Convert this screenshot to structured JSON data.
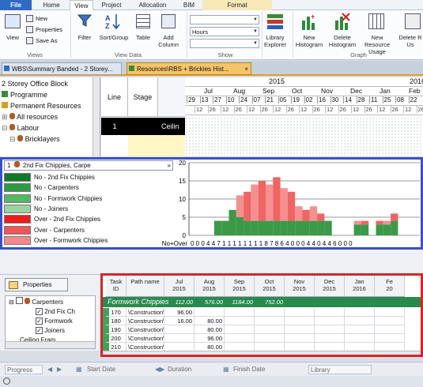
{
  "ribbon_tabs": [
    "File",
    "Home",
    "View",
    "Project",
    "Allocation",
    "BIM",
    "Format"
  ],
  "ribbon": {
    "views": {
      "view_label": "View",
      "new_label": "New",
      "properties_label": "Properties",
      "saveas_label": "Save As",
      "group_label": "Views"
    },
    "viewdata": {
      "filter_label": "Filter",
      "sortgroup_label": "Sort/Group",
      "table_label": "Table",
      "addcolumn_label": "Add Column",
      "group_label": "View Data"
    },
    "show": {
      "combo1": "",
      "combo2": "Hours",
      "combo3": "",
      "group_label": "Show"
    },
    "library_label": "Library Explorer",
    "graph": {
      "new_hist": "New Histogram",
      "delete_hist": "Delete Histogram",
      "new_usage": "New Resource Usage",
      "delete_usage": "Delete R Us",
      "group_label": "Graph"
    }
  },
  "doc_tabs": [
    "WBS\\Summary Banded - 2 Storey...",
    "Resources\\RBS + Brickies Hist..."
  ],
  "tree_top": [
    "2 Storey Office Block",
    "Programme",
    "Permanent Resources",
    "All resources",
    "Labour",
    "Bricklayers"
  ],
  "grid_top": {
    "line_header": "Line",
    "stage_header": "Stage",
    "row_line": "1",
    "row_text": "Ceilin"
  },
  "timeline": {
    "year1": "2015",
    "year2": "2016",
    "months": [
      "Jul",
      "Aug",
      "Sep",
      "Oct",
      "Nov",
      "Dec",
      "Jan",
      "Feb"
    ],
    "weeks1": [
      "29",
      "13",
      "27",
      "10",
      "24",
      "07",
      "21",
      "05",
      "19",
      "02",
      "16",
      "30",
      "14",
      "28",
      "11",
      "25",
      "08",
      "22"
    ],
    "weeks2": [
      "12",
      "26",
      "12",
      "26",
      "12",
      "26",
      "12",
      "26",
      "12",
      "26",
      "12",
      "26",
      "12",
      "26",
      "12",
      "26",
      "12",
      "26"
    ]
  },
  "histogram": {
    "selector": "2nd Fix Chippies, Carpe",
    "legend": [
      {
        "label": "No - 2nd Fix Chippies",
        "color": "#0f7a2a"
      },
      {
        "label": "No - Carpenters",
        "color": "#2f9a45"
      },
      {
        "label": "No - Formwork Chippies",
        "color": "#55b862"
      },
      {
        "label": "No - Joiners",
        "color": "#9bd39f"
      },
      {
        "label": "Over - 2nd Fix Chippies",
        "color": "#ee1c1c"
      },
      {
        "label": "Over - Carpenters",
        "color": "#f05656"
      },
      {
        "label": "Over - Formwork Chippies",
        "color": "#f58888"
      }
    ],
    "yticks": [
      "20",
      "15",
      "10",
      "5",
      "0"
    ],
    "nolabel": "No+Over",
    "values_row": "0 0 0 4 4 7 1 1 1 1 1 1 1 1 8 7 8 6 4 0 0 0 4 4 0 4 4 6 0 0 0"
  },
  "props_button": "Properties",
  "tree_bottom": [
    "Carpenters",
    "2nd Fix Ch",
    "Formwork",
    "Joiners",
    "Ceiling Fram"
  ],
  "bottom_grid": {
    "headers": [
      {
        "l1": "Task",
        "l2": "ID"
      },
      {
        "l1": "Path name",
        "l2": ""
      },
      {
        "l1": "Jul",
        "l2": "2015"
      },
      {
        "l1": "Aug",
        "l2": "2015"
      },
      {
        "l1": "Sep",
        "l2": "2015"
      },
      {
        "l1": "Oct",
        "l2": "2015"
      },
      {
        "l1": "Nov",
        "l2": "2015"
      },
      {
        "l1": "Dec",
        "l2": "2015"
      },
      {
        "l1": "Jan",
        "l2": "2016"
      },
      {
        "l1": "Fe",
        "l2": "20"
      }
    ],
    "group_row": {
      "name": "Formwork Chippies",
      "values": [
        "112.00",
        "576.00",
        "1184.00",
        "752.00",
        "",
        "",
        "",
        ""
      ]
    },
    "rows": [
      {
        "id": "170",
        "path": "\\Construction\\S",
        "values": [
          "96.00",
          "",
          "",
          "",
          "",
          "",
          "",
          ""
        ]
      },
      {
        "id": "180",
        "path": "\\Construction\\S",
        "values": [
          "16.00",
          "80.00",
          "",
          "",
          "",
          "",
          "",
          ""
        ]
      },
      {
        "id": "190",
        "path": "\\Construction\\S",
        "values": [
          "",
          "80.00",
          "",
          "",
          "",
          "",
          "",
          ""
        ]
      },
      {
        "id": "200",
        "path": "\\Construction\\S",
        "values": [
          "",
          "96.00",
          "",
          "",
          "",
          "",
          "",
          ""
        ]
      },
      {
        "id": "210",
        "path": "\\Construction\\S",
        "values": [
          "",
          "80.00",
          "",
          "",
          "",
          "",
          "",
          ""
        ]
      }
    ]
  },
  "status": {
    "progress": "Progress",
    "start": "Start Date",
    "duration": "Duration",
    "finish": "Finish Date",
    "library": "Library"
  }
}
